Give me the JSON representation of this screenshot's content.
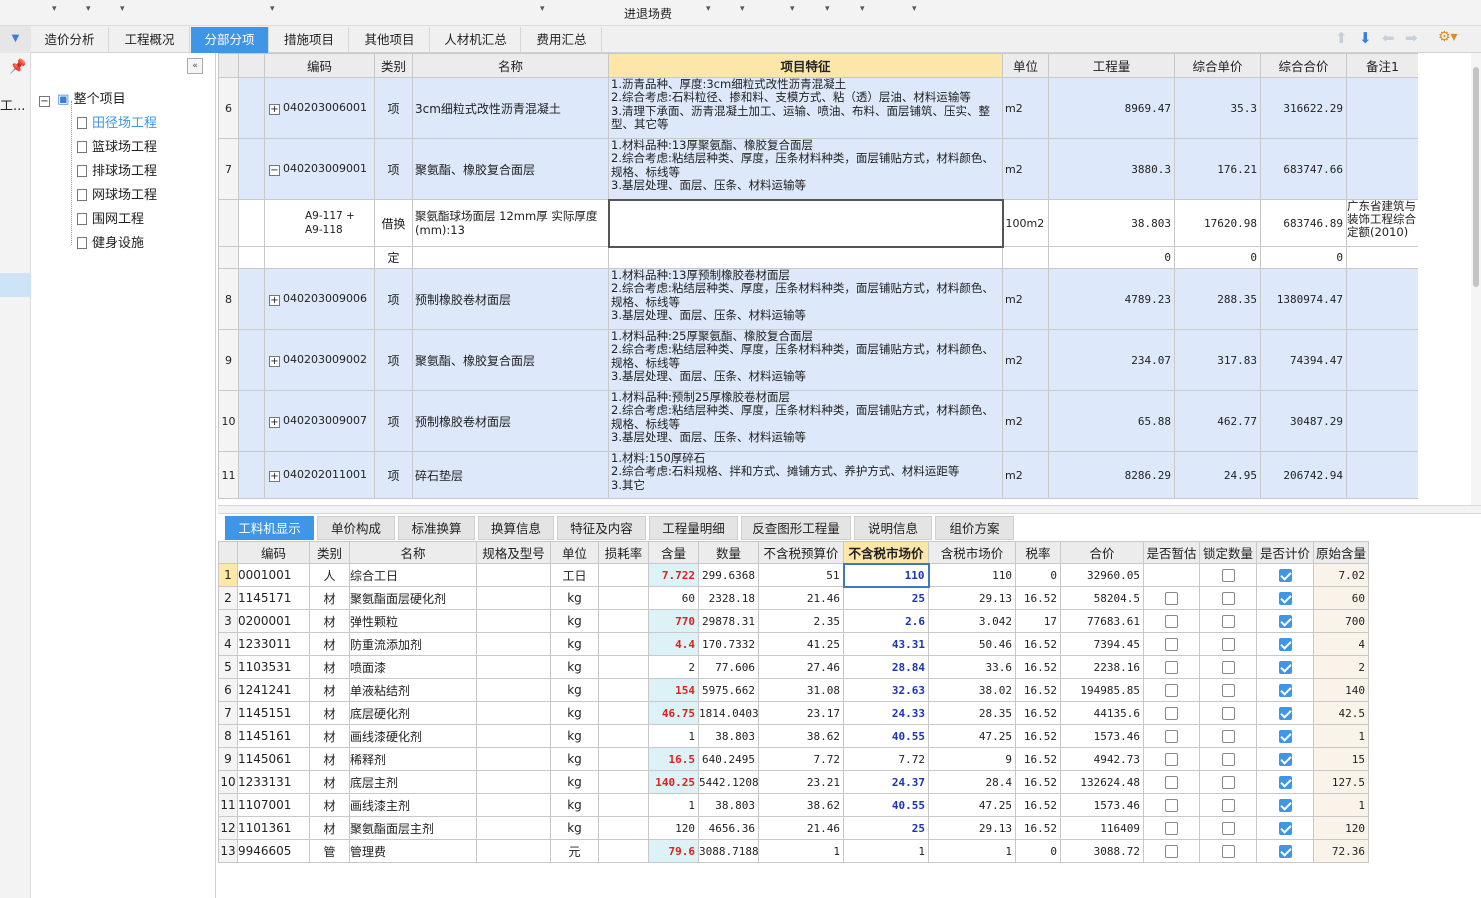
{
  "topbar": {
    "title": "进退场费"
  },
  "tabs": [
    {
      "label": "造价分析"
    },
    {
      "label": "工程概况"
    },
    {
      "label": "分部分项"
    },
    {
      "label": "措施项目"
    },
    {
      "label": "其他项目"
    },
    {
      "label": "人材机汇总"
    },
    {
      "label": "费用汇总"
    }
  ],
  "sidebar": {
    "strip_label": "工..."
  },
  "tree": {
    "root": "整个项目",
    "items": [
      {
        "label": "田径场工程"
      },
      {
        "label": "篮球场工程"
      },
      {
        "label": "排球场工程"
      },
      {
        "label": "网球场工程"
      },
      {
        "label": "围网工程"
      },
      {
        "label": "健身设施"
      }
    ]
  },
  "upper": {
    "headers": [
      "编码",
      "类别",
      "名称",
      "项目特征",
      "单位",
      "工程量",
      "综合单价",
      "综合合价",
      "备注1"
    ],
    "rows": [
      {
        "no": "6",
        "code": "040203006001",
        "type": "项",
        "name": "3cm细粒式改性沥青混凝土",
        "feature": "1.沥青品种、厚度:3cm细粒式改性沥青混凝土\n2.综合考虑:石料粒径、掺和料、支模方式、粘（透）层油、材料运输等\n3.清理下承面、沥青混凝土加工、运输、喷油、布料、面层铺筑、压实、整型、其它等",
        "unit": "m2",
        "qty": "8969.47",
        "price": "35.3",
        "total": "316622.29",
        "note": ""
      },
      {
        "no": "7",
        "code": "040203009001",
        "type": "项",
        "name": "聚氨酯、橡胶复合面层",
        "feature": "1.材料品种:13厚聚氨酯、橡胶复合面层\n2.综合考虑:粘结层种类、厚度，压条材料种类，面层铺贴方式，材料颜色、规格、标线等\n3.基层处理、面层、压条、材料运输等",
        "unit": "m2",
        "qty": "3880.3",
        "price": "176.21",
        "total": "683747.66",
        "note": ""
      },
      {
        "no": "",
        "code": "A9-117 +\nA9-118",
        "type": "借换",
        "name": "聚氨酯球场面层 12mm厚  实际厚度(mm):13",
        "feature": "",
        "unit": "100m2",
        "qty": "38.803",
        "price": "17620.98",
        "total": "683746.89",
        "note": "广东省建筑与装饰工程综合定额(2010)"
      },
      {
        "no": "",
        "code": "",
        "type": "定",
        "name": "",
        "feature": "",
        "unit": "",
        "qty": "0",
        "price": "0",
        "total": "0",
        "note": ""
      },
      {
        "no": "8",
        "code": "040203009006",
        "type": "项",
        "name": "预制橡胶卷材面层",
        "feature": "1.材料品种:13厚预制橡胶卷材面层\n2.综合考虑:粘结层种类、厚度，压条材料种类，面层铺贴方式，材料颜色、规格、标线等\n3.基层处理、面层、压条、材料运输等",
        "unit": "m2",
        "qty": "4789.23",
        "price": "288.35",
        "total": "1380974.47",
        "note": ""
      },
      {
        "no": "9",
        "code": "040203009002",
        "type": "项",
        "name": "聚氨酯、橡胶复合面层",
        "feature": "1.材料品种:25厚聚氨酯、橡胶复合面层\n2.综合考虑:粘结层种类、厚度，压条材料种类，面层铺贴方式，材料颜色、规格、标线等\n3.基层处理、面层、压条、材料运输等",
        "unit": "m2",
        "qty": "234.07",
        "price": "317.83",
        "total": "74394.47",
        "note": ""
      },
      {
        "no": "10",
        "code": "040203009007",
        "type": "项",
        "name": "预制橡胶卷材面层",
        "feature": "1.材料品种:预制25厚橡胶卷材面层\n2.综合考虑:粘结层种类、厚度，压条材料种类，面层铺贴方式，材料颜色、规格、标线等\n3.基层处理、面层、压条、材料运输等",
        "unit": "m2",
        "qty": "65.88",
        "price": "462.77",
        "total": "30487.29",
        "note": ""
      },
      {
        "no": "11",
        "code": "040202011001",
        "type": "项",
        "name": "碎石垫层",
        "feature": "1.材料:150厚碎石\n2.综合考虑:石料规格、拌和方式、摊铺方式、养护方式、材料运距等\n3.其它",
        "unit": "m2",
        "qty": "8286.29",
        "price": "24.95",
        "total": "206742.94",
        "note": ""
      }
    ]
  },
  "lower_tabs": [
    {
      "label": "工料机显示"
    },
    {
      "label": "单价构成"
    },
    {
      "label": "标准换算"
    },
    {
      "label": "换算信息"
    },
    {
      "label": "特征及内容"
    },
    {
      "label": "工程量明细"
    },
    {
      "label": "反查图形工程量"
    },
    {
      "label": "说明信息"
    },
    {
      "label": "组价方案"
    }
  ],
  "lower": {
    "headers": [
      "编码",
      "类别",
      "名称",
      "规格及型号",
      "单位",
      "损耗率",
      "含量",
      "数量",
      "不含税预算价",
      "不含税市场价",
      "含税市场价",
      "税率",
      "合价",
      "是否暂估",
      "锁定数量",
      "是否计价",
      "原始含量"
    ],
    "rows": [
      {
        "no": "1",
        "code": "0001001",
        "type": "人",
        "name": "综合工日",
        "spec": "",
        "unit": "工日",
        "loss": "",
        "content": "7.722",
        "hl": true,
        "qty": "299.6368",
        "budget": "51",
        "market": "110",
        "taxed": "110",
        "rate": "0",
        "total": "32960.05",
        "est": false,
        "lock": false,
        "priced": true,
        "orig": "7.02"
      },
      {
        "no": "2",
        "code": "1145171",
        "type": "材",
        "name": "聚氨酯面层硬化剂",
        "spec": "",
        "unit": "kg",
        "loss": "",
        "content": "60",
        "hl": false,
        "qty": "2328.18",
        "budget": "21.46",
        "market": "25",
        "taxed": "29.13",
        "rate": "16.52",
        "total": "58204.5",
        "est": false,
        "lock": false,
        "priced": true,
        "orig": "60"
      },
      {
        "no": "3",
        "code": "0200001",
        "type": "材",
        "name": "弹性颗粒",
        "spec": "",
        "unit": "kg",
        "loss": "",
        "content": "770",
        "hl": true,
        "qty": "29878.31",
        "budget": "2.35",
        "market": "2.6",
        "taxed": "3.042",
        "rate": "17",
        "total": "77683.61",
        "est": false,
        "lock": false,
        "priced": true,
        "orig": "700"
      },
      {
        "no": "4",
        "code": "1233011",
        "type": "材",
        "name": "防重流添加剂",
        "spec": "",
        "unit": "kg",
        "loss": "",
        "content": "4.4",
        "hl": true,
        "qty": "170.7332",
        "budget": "41.25",
        "market": "43.31",
        "taxed": "50.46",
        "rate": "16.52",
        "total": "7394.45",
        "est": false,
        "lock": false,
        "priced": true,
        "orig": "4"
      },
      {
        "no": "5",
        "code": "1103531",
        "type": "材",
        "name": "喷面漆",
        "spec": "",
        "unit": "kg",
        "loss": "",
        "content": "2",
        "hl": false,
        "qty": "77.606",
        "budget": "27.46",
        "market": "28.84",
        "taxed": "33.6",
        "rate": "16.52",
        "total": "2238.16",
        "est": false,
        "lock": false,
        "priced": true,
        "orig": "2"
      },
      {
        "no": "6",
        "code": "1241241",
        "type": "材",
        "name": "单液粘结剂",
        "spec": "",
        "unit": "kg",
        "loss": "",
        "content": "154",
        "hl": true,
        "qty": "5975.662",
        "budget": "31.08",
        "market": "32.63",
        "taxed": "38.02",
        "rate": "16.52",
        "total": "194985.85",
        "est": false,
        "lock": false,
        "priced": true,
        "orig": "140"
      },
      {
        "no": "7",
        "code": "1145151",
        "type": "材",
        "name": "底层硬化剂",
        "spec": "",
        "unit": "kg",
        "loss": "",
        "content": "46.75",
        "hl": true,
        "qty": "1814.0403",
        "budget": "23.17",
        "market": "24.33",
        "taxed": "28.35",
        "rate": "16.52",
        "total": "44135.6",
        "est": false,
        "lock": false,
        "priced": true,
        "orig": "42.5"
      },
      {
        "no": "8",
        "code": "1145161",
        "type": "材",
        "name": "画线漆硬化剂",
        "spec": "",
        "unit": "kg",
        "loss": "",
        "content": "1",
        "hl": false,
        "qty": "38.803",
        "budget": "38.62",
        "market": "40.55",
        "taxed": "47.25",
        "rate": "16.52",
        "total": "1573.46",
        "est": false,
        "lock": false,
        "priced": true,
        "orig": "1"
      },
      {
        "no": "9",
        "code": "1145061",
        "type": "材",
        "name": "稀释剂",
        "spec": "",
        "unit": "kg",
        "loss": "",
        "content": "16.5",
        "hl": true,
        "qty": "640.2495",
        "budget": "7.72",
        "market": "7.72",
        "taxed": "9",
        "rate": "16.52",
        "total": "4942.73",
        "est": false,
        "lock": false,
        "priced": true,
        "orig": "15",
        "plain": true
      },
      {
        "no": "10",
        "code": "1233131",
        "type": "材",
        "name": "底层主剂",
        "spec": "",
        "unit": "kg",
        "loss": "",
        "content": "140.25",
        "hl": true,
        "qty": "5442.1208",
        "budget": "23.21",
        "market": "24.37",
        "taxed": "28.4",
        "rate": "16.52",
        "total": "132624.48",
        "est": false,
        "lock": false,
        "priced": true,
        "orig": "127.5"
      },
      {
        "no": "11",
        "code": "1107001",
        "type": "材",
        "name": "画线漆主剂",
        "spec": "",
        "unit": "kg",
        "loss": "",
        "content": "1",
        "hl": false,
        "qty": "38.803",
        "budget": "38.62",
        "market": "40.55",
        "taxed": "47.25",
        "rate": "16.52",
        "total": "1573.46",
        "est": false,
        "lock": false,
        "priced": true,
        "orig": "1"
      },
      {
        "no": "12",
        "code": "1101361",
        "type": "材",
        "name": "聚氨酯面层主剂",
        "spec": "",
        "unit": "kg",
        "loss": "",
        "content": "120",
        "hl": false,
        "qty": "4656.36",
        "budget": "21.46",
        "market": "25",
        "taxed": "29.13",
        "rate": "16.52",
        "total": "116409",
        "est": false,
        "lock": false,
        "priced": true,
        "orig": "120"
      },
      {
        "no": "13",
        "code": "9946605",
        "type": "管",
        "name": "管理费",
        "spec": "",
        "unit": "元",
        "loss": "",
        "content": "79.6",
        "hl": true,
        "qty": "3088.7188",
        "budget": "1",
        "market": "1",
        "taxed": "1",
        "rate": "0",
        "total": "3088.72",
        "est": false,
        "lock": false,
        "priced": true,
        "orig": "72.36",
        "plain": true
      }
    ]
  }
}
